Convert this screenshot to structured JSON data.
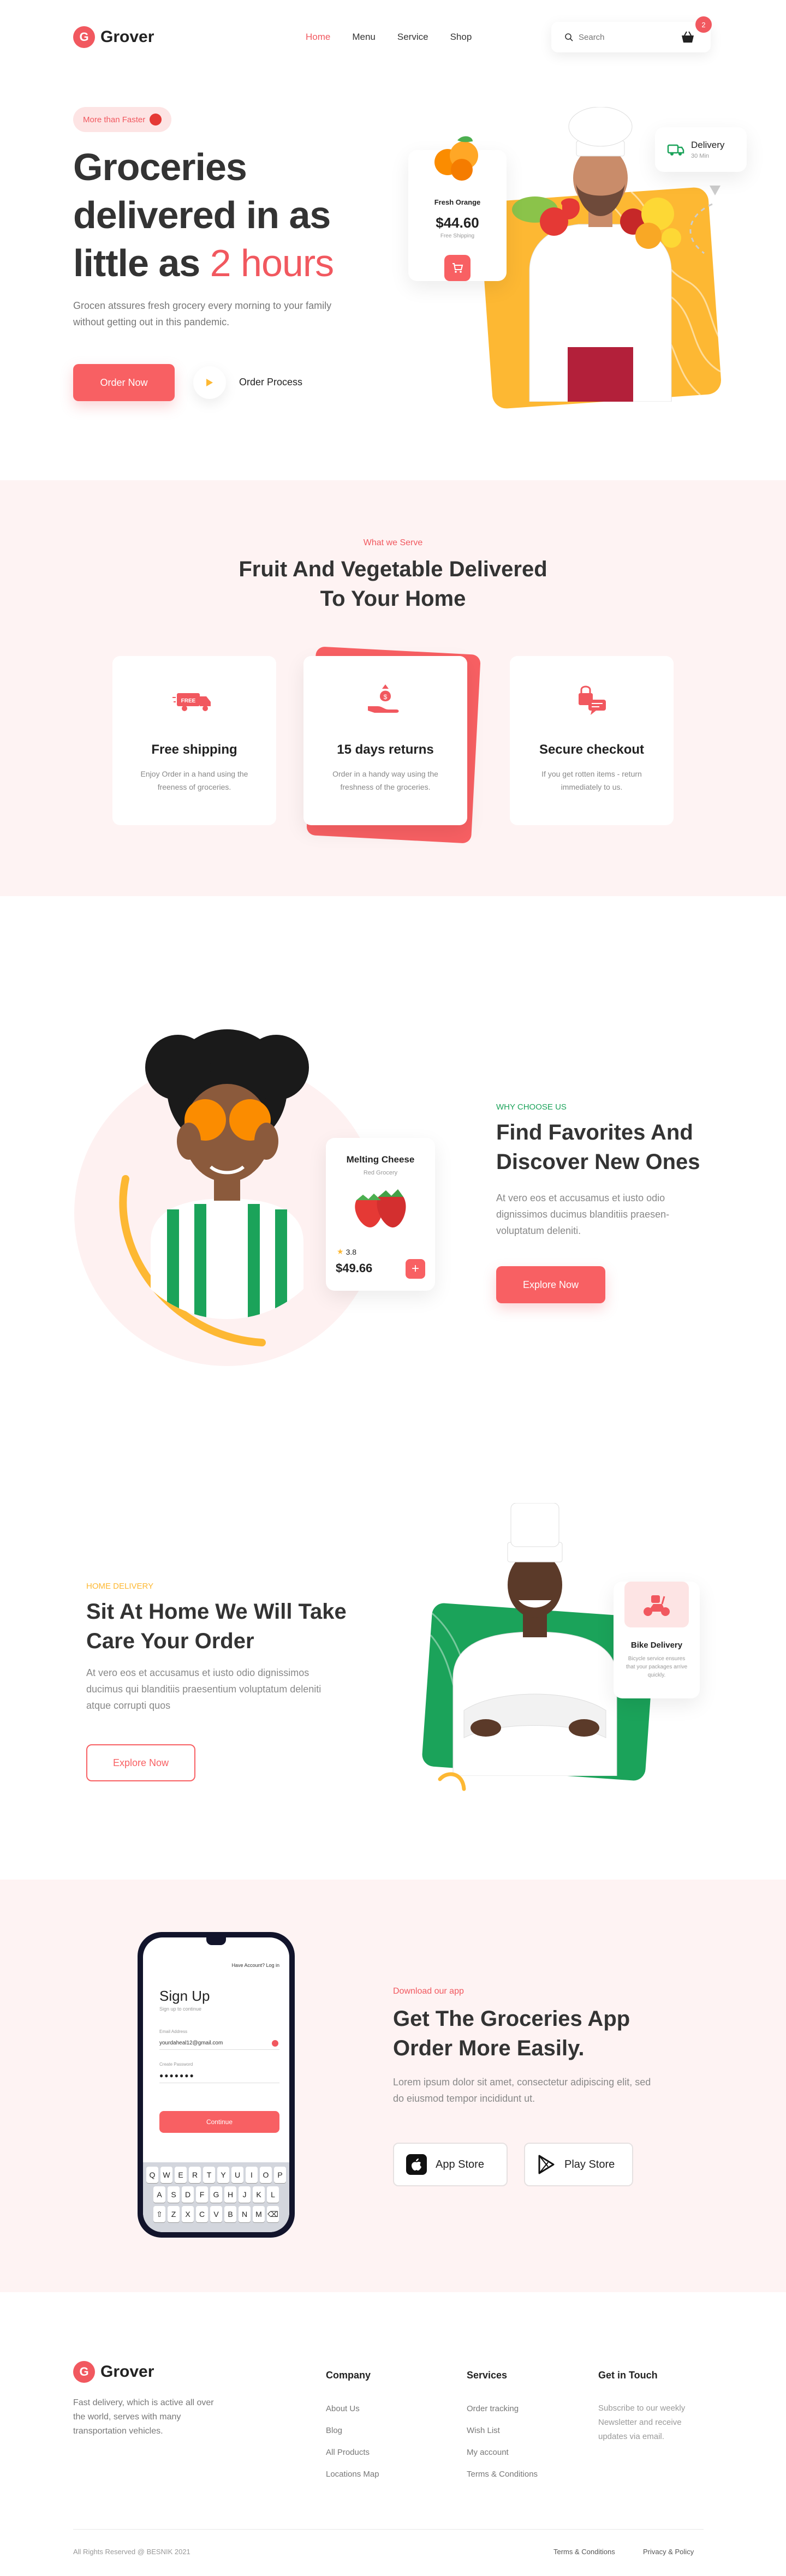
{
  "brand": {
    "name": "Grover",
    "accent": "#F1585F",
    "yellow": "#FDB833",
    "green": "#1BA35A"
  },
  "nav": {
    "links": [
      "Home",
      "Menu",
      "Service",
      "Shop"
    ],
    "active": "Home",
    "search_placeholder": "Search",
    "cart_count": "2"
  },
  "hero": {
    "pill": "More than Faster",
    "title_line1": "Groceries",
    "title_line2": "delivered in as",
    "title_line3_prefix": "little as ",
    "title_line3_accent": "2 hours",
    "subtitle": "Grocen atssures fresh grocery every morning to your family without getting out in this pandemic.",
    "order_button": "Order Now",
    "process_label": "Order Process",
    "product_card": {
      "name": "Fresh Orange",
      "price": "$44.60",
      "note": "Free Shipping"
    },
    "delivery_card": {
      "title": "Delivery",
      "sub": "30 Min"
    }
  },
  "serve": {
    "eyebrow": "What we Serve",
    "title_line1": "Fruit And Vegetable Delivered",
    "title_line2": "To Your Home",
    "services": [
      {
        "icon": "delivery-truck-icon",
        "badge": "FREE",
        "title": "Free shipping",
        "desc": "Enjoy Order in a hand using the freeness of groceries."
      },
      {
        "icon": "money-hand-icon",
        "title": "15 days returns",
        "desc": "Order in a handy way using the freshness of the groceries."
      },
      {
        "icon": "checkout-lock-icon",
        "title": "Secure checkout",
        "desc": "If you get rotten items - return immediately to us."
      }
    ]
  },
  "why": {
    "eyebrow": "WHY CHOOSE US",
    "title_line1": "Find Favorites And",
    "title_line2": "Discover New Ones",
    "desc": "At vero eos et accusamus et iusto odio dignissimos ducimus blanditiis praesen-voluptatum deleniti.",
    "button": "Explore Now",
    "card": {
      "name": "Melting Cheese",
      "sub": "Red Grocery",
      "rating": "3.8",
      "price": "$49.66"
    }
  },
  "home": {
    "eyebrow": "HOME DELIVERY",
    "title_line1": "Sit At Home We Will Take",
    "title_line2": "Care Your Order",
    "desc": "At vero eos et accusamus et iusto odio dignissimos ducimus qui blanditiis praesentium voluptatum deleniti atque corrupti quos",
    "button": "Explore Now",
    "card": {
      "title": "Bike Delivery",
      "desc": "Bicycle service ensures that your packages arrive quickly."
    }
  },
  "app": {
    "eyebrow": "Download our app",
    "title_line1": "Get The Groceries App",
    "title_line2": "Order More Easily.",
    "desc": "Lorem ipsum dolor sit amet, consectetur adipiscing elit, sed do eiusmod tempor incididunt ut.",
    "app_store": "App Store",
    "play_store": "Play Store",
    "phone": {
      "top_link": "Have Account? Log in",
      "title": "Sign Up",
      "subtitle": "Sign up to continue",
      "email_label": "Email Address",
      "email_value": "yourdaheal12@gmail.com",
      "password_label": "Create Password",
      "password_value": "●●●●●●●",
      "continue": "Continue",
      "keyboard": [
        [
          "Q",
          "W",
          "E",
          "R",
          "T",
          "Y",
          "U",
          "I",
          "O",
          "P"
        ],
        [
          "A",
          "S",
          "D",
          "F",
          "G",
          "H",
          "J",
          "K",
          "L"
        ],
        [
          "⇧",
          "Z",
          "X",
          "C",
          "V",
          "B",
          "N",
          "M",
          "⌫"
        ]
      ]
    }
  },
  "footer": {
    "tagline": "Fast delivery, which is active all over the world, serves with many transportation vehicles.",
    "columns": [
      {
        "title": "Company",
        "links": [
          "About Us",
          "Blog",
          "All Products",
          "Locations Map"
        ]
      },
      {
        "title": "Services",
        "links": [
          "Order tracking",
          "Wish List",
          "My account",
          "Terms & Conditions"
        ]
      }
    ],
    "contact_title": "Get in Touch",
    "contact_text": "Subscribe to our weekly Newsletter and receive updates via email.",
    "copyright": "All Rights Reserved @ BESNIK 2021",
    "bottom_links": [
      "Terms & Conditions",
      "Privacy & Policy"
    ]
  }
}
